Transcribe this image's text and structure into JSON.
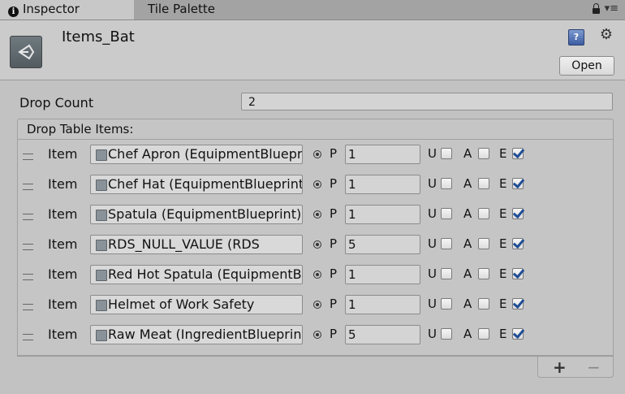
{
  "tabs": {
    "inspector": "Inspector",
    "tile_palette": "Tile Palette"
  },
  "header": {
    "object_name": "Items_Bat",
    "open_label": "Open"
  },
  "fields": {
    "drop_count_label": "Drop Count",
    "drop_count_value": "2"
  },
  "list": {
    "title": "Drop Table Items:",
    "item_label": "Item",
    "p_label": "P",
    "u_label": "U",
    "a_label": "A",
    "e_label": "E",
    "rows": [
      {
        "object": "Chef Apron (EquipmentBlueprint)",
        "p": "1",
        "u": false,
        "a": false,
        "e": true
      },
      {
        "object": "Chef Hat (EquipmentBlueprint)",
        "p": "1",
        "u": false,
        "a": false,
        "e": true
      },
      {
        "object": "Spatula (EquipmentBlueprint)",
        "p": "1",
        "u": false,
        "a": false,
        "e": true
      },
      {
        "object": "RDS_NULL_VALUE (RDS",
        "p": "5",
        "u": false,
        "a": false,
        "e": true
      },
      {
        "object": "Red Hot Spatula (EquipmentBlueprint)",
        "p": "1",
        "u": false,
        "a": false,
        "e": true
      },
      {
        "object": "Helmet of Work Safety",
        "p": "1",
        "u": false,
        "a": false,
        "e": true
      },
      {
        "object": "Raw Meat (IngredientBlueprint)",
        "p": "5",
        "u": false,
        "a": false,
        "e": true
      }
    ],
    "add_label": "+",
    "remove_label": "−"
  },
  "colors": {
    "check": "#1f4e96",
    "background": "#c2c2c2"
  }
}
